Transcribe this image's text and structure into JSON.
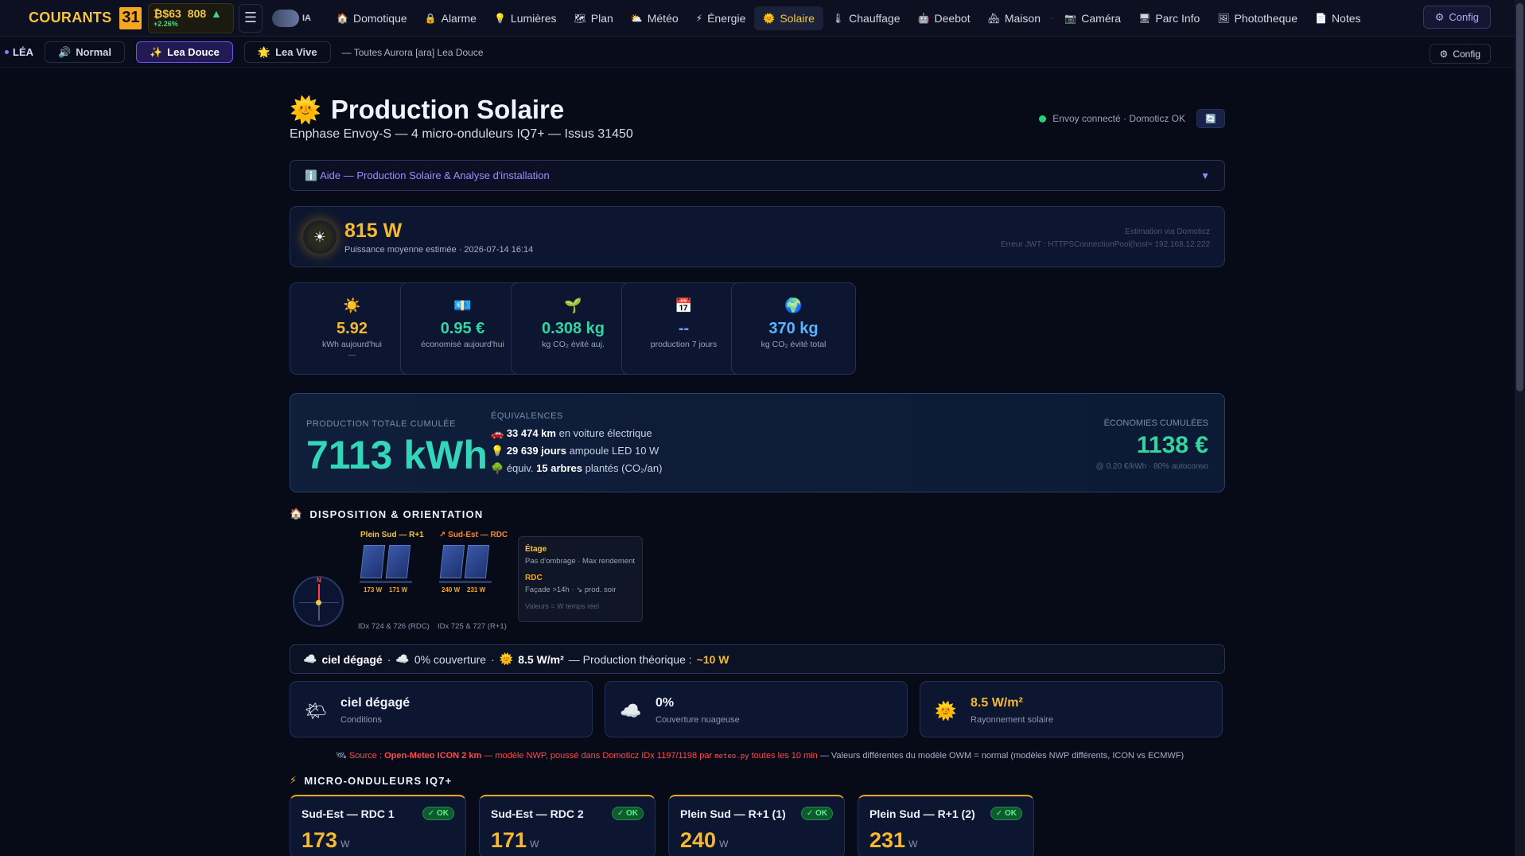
{
  "brand": {
    "name": "COURANTS",
    "day": "31"
  },
  "btc": {
    "symbol": "₿",
    "price": "$63",
    "price2": "808",
    "arrow": "▲",
    "change": "+2.26%"
  },
  "ia": {
    "label": "IA"
  },
  "nav": [
    {
      "icon": "🏠",
      "label": "Domotique"
    },
    {
      "icon": "🔒",
      "label": "Alarme"
    },
    {
      "icon": "💡",
      "label": "Lumières"
    },
    {
      "icon": "🗺",
      "label": "Plan"
    },
    {
      "icon": "⛅",
      "label": "Météo"
    },
    {
      "icon": "⚡",
      "label": "Énergie"
    },
    {
      "icon": "🌞",
      "label": "Solaire",
      "active": true
    },
    {
      "icon": "🌡",
      "label": "Chauffage"
    },
    {
      "icon": "🤖",
      "label": "Deebot"
    },
    {
      "icon": "🏘",
      "label": "Maison"
    },
    {
      "icon": "📷",
      "label": "Caméra"
    },
    {
      "icon": "🖥",
      "label": "Parc Info"
    },
    {
      "icon": "🖼",
      "label": "Phototheque"
    },
    {
      "icon": "📄",
      "label": "Notes"
    }
  ],
  "config_label": "Config",
  "subbar": {
    "lea": "LÉA",
    "modes": [
      {
        "icon": "🔊",
        "label": "Normal"
      },
      {
        "icon": "✨",
        "label": "Lea Douce",
        "active": true
      },
      {
        "icon": "🌟",
        "label": "Lea Vive"
      }
    ],
    "text": "— Toutes Aurora [ara] Lea Douce",
    "config": "Config"
  },
  "page": {
    "icon": "🌞",
    "title": "Production Solaire",
    "subtitle": "Enphase Envoy-S — 4 micro-onduleurs IQ7+ — Issus 31450",
    "status": "Envoy connecté · Domoticz OK",
    "refresh": "🔄"
  },
  "help": {
    "label": "ℹ️ Aide — Production Solaire & Analyse d'installation",
    "chev": "▼"
  },
  "now": {
    "value": "815 W",
    "sub": "Puissance moyenne estimée · 2026-07-14 16:14",
    "est1": "Estimation via Domoticz",
    "est2": "Erreur JWT : HTTPSConnectionPool(host= 192.168.12.222"
  },
  "kpis": [
    {
      "icon": "☀️",
      "value": "5.92",
      "label": "kWh aujourd'hui",
      "extra": "—",
      "color": "#f5b82e"
    },
    {
      "icon": "💶",
      "value": "0.95 €",
      "label": "économisé aujourd'hui",
      "extra": "",
      "color": "#33d6a0"
    },
    {
      "icon": "🌱",
      "value": "0.308 kg",
      "label": "kg CO₂ évité auj.",
      "extra": "",
      "color": "#33d6a0"
    },
    {
      "icon": "📅",
      "value": "--",
      "label": "production 7 jours",
      "extra": "",
      "color": "#7a9cff"
    },
    {
      "icon": "🌍",
      "value": "370 kg",
      "label": "kg CO₂ évité total",
      "extra": "",
      "color": "#5ab4ff"
    }
  ],
  "total": {
    "label": "PRODUCTION TOTALE CUMULÉE",
    "value": "7113 kWh",
    "eq_head": "ÉQUIVALENCES",
    "eq": [
      {
        "icon": "🚗",
        "bold": "33 474 km",
        "text": " en voiture électrique"
      },
      {
        "icon": "💡",
        "bold": "29 639 jours",
        "text": " ampoule LED 10 W"
      },
      {
        "icon": "🌳",
        "pre": "équiv. ",
        "bold": "15 arbres",
        "text": " plantés (CO₂/an)"
      }
    ],
    "econ_label": "ÉCONOMIES CUMULÉES",
    "econ_value": "1138 €",
    "econ_sub": "@ 0.20 €/kWh · 80% autoconso"
  },
  "dispo": {
    "title": "DISPOSITION & ORIENTATION",
    "icon": "🏠",
    "compass_n": "N",
    "g1": {
      "label": "Plein Sud — R+1",
      "w1": "173 W",
      "w2": "171 W",
      "idx": "IDx 724 & 726 (RDC)"
    },
    "g2": {
      "label": "↗ Sud-Est — RDC",
      "w1": "240 W",
      "w2": "231 W",
      "idx": "IDx 725 & 727 (R+1)"
    },
    "legend": {
      "h1": "Étage",
      "t1": "Pas d'ombrage · Max rendement",
      "h2": "RDC",
      "t2": "Façade >14h · ↘ prod. soir",
      "note": "Valeurs = W temps réel"
    }
  },
  "weather": {
    "icon1": "☁️",
    "cond": "ciel dégagé",
    "icon2": "☁️",
    "cover": "0% couverture",
    "icon3": "🌞",
    "irr": "8.5 W/m²",
    "theo_label": "— Production théorique :",
    "theo": "~10 W",
    "cards": [
      {
        "icon": "🌤",
        "value": "ciel dégagé",
        "label": "Conditions"
      },
      {
        "icon": "☁️",
        "value": "0%",
        "label": "Couverture nuageuse"
      },
      {
        "icon": "🌞",
        "value": "8.5 W/m²",
        "label": "Rayonnement solaire",
        "color": "#f5b82e"
      }
    ]
  },
  "source": {
    "icon": "🛰",
    "pre": "Source : ",
    "name": "Open-Meteo ICON 2 km",
    "mid": " — modèle NWP, poussé dans Domoticz IDx 1197/1198 par ",
    "code": "meteo.py",
    "post": " toutes les 10 min",
    "tail": " — Valeurs différentes du modèle OWM = normal (modèles NWP différents, ICON vs ECMWF)"
  },
  "inv_title": "MICRO-ONDULEURS IQ7+",
  "inv_icon": "⚡",
  "inverters": [
    {
      "name": "Sud-Est — RDC 1",
      "ok": "✓ OK",
      "w": "173",
      "u": "W"
    },
    {
      "name": "Sud-Est — RDC 2",
      "ok": "✓ OK",
      "w": "171",
      "u": "W"
    },
    {
      "name": "Plein Sud — R+1 (1)",
      "ok": "✓ OK",
      "w": "240",
      "u": "W"
    },
    {
      "name": "Plein Sud — R+1 (2)",
      "ok": "✓ OK",
      "w": "231",
      "u": "W"
    }
  ]
}
